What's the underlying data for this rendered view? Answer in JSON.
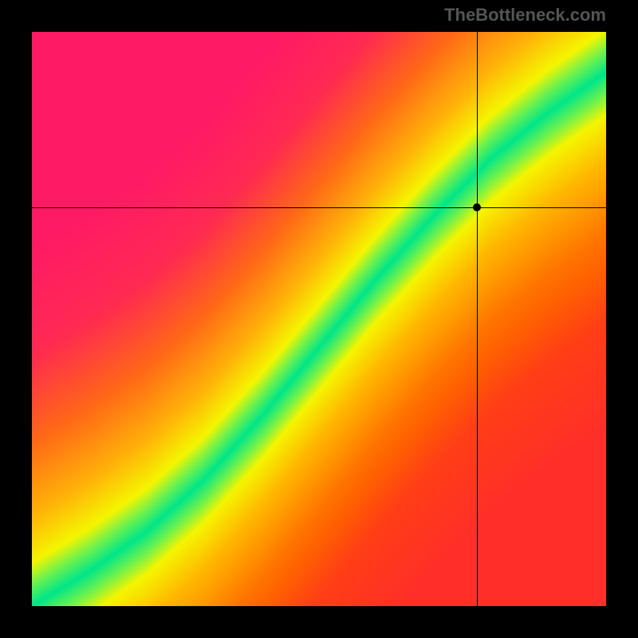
{
  "watermark": "TheBottleneck.com",
  "chart_data": {
    "type": "heatmap",
    "title": "",
    "xlabel": "",
    "ylabel": "",
    "xlim": [
      0,
      1
    ],
    "ylim": [
      0,
      1
    ],
    "crosshair": {
      "x": 0.775,
      "y": 0.695
    },
    "marker": {
      "x": 0.775,
      "y": 0.695
    },
    "optimal_band": {
      "description": "Diagonal green band where components are balanced; red = bottleneck; yellow = transitional",
      "curve_points": [
        {
          "x": 0.0,
          "y": 0.0
        },
        {
          "x": 0.1,
          "y": 0.06
        },
        {
          "x": 0.2,
          "y": 0.13
        },
        {
          "x": 0.3,
          "y": 0.22
        },
        {
          "x": 0.4,
          "y": 0.33
        },
        {
          "x": 0.5,
          "y": 0.45
        },
        {
          "x": 0.6,
          "y": 0.57
        },
        {
          "x": 0.7,
          "y": 0.68
        },
        {
          "x": 0.8,
          "y": 0.78
        },
        {
          "x": 0.9,
          "y": 0.86
        },
        {
          "x": 1.0,
          "y": 0.93
        }
      ],
      "band_half_width": 0.055
    },
    "color_scale": [
      {
        "dist": 0.0,
        "color": "#00e68a"
      },
      {
        "dist": 0.06,
        "color": "#6ef24d"
      },
      {
        "dist": 0.12,
        "color": "#f5f500"
      },
      {
        "dist": 0.25,
        "color": "#ffb300"
      },
      {
        "dist": 0.45,
        "color": "#ff6a00"
      },
      {
        "dist": 0.7,
        "color": "#ff2a2a"
      },
      {
        "dist": 1.0,
        "color": "#ff1a3d"
      }
    ]
  }
}
